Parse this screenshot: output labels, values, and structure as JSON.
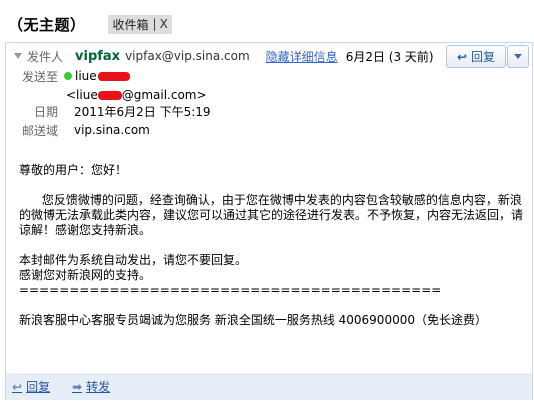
{
  "subject": "（无主题）",
  "label": {
    "name": "收件箱",
    "remove": "X"
  },
  "header": {
    "from_label": "发件人",
    "sender_name": "vipfax",
    "sender_email": "vipfax@vip.sina.com",
    "hide_details": "隐藏详细信息",
    "date_short": "6月2日 (3 天前)",
    "to_label": "发送至",
    "to_name": "liue",
    "to_email_prefix": "<liue",
    "to_email_suffix": "@gmail.com>",
    "date_label": "日期",
    "date_full": "2011年6月2日 下午5:19",
    "mailed_by_label": "邮送域",
    "mailed_by": "vip.sina.com"
  },
  "actions": {
    "reply": "回复",
    "forward": "转发"
  },
  "body": {
    "greeting": "尊敬的用户：您好！",
    "paragraph": "      您反馈微博的问题，经查询确认，由于您在微博中发表的内容包含较敏感的信息内容，新浪的微博无法承载此类内容，建议您可以通过其它的途径进行发表。不予恢复，内容无法返回，请谅解！感谢您支持新浪。",
    "notice": "本封邮件为系统自动发出，请您不要回复。",
    "thanks": "感谢您对新浪网的支持。",
    "divider": "==========================================",
    "signature": "新浪客服中心客服专员竭诚为您服务 新浪全国统一服务热线 4006900000（免长途费）"
  },
  "colors": {
    "sender": "#006633",
    "link": "#3366cc",
    "status_dot": "#33cc33",
    "footer_bg": "#e8eef7"
  }
}
